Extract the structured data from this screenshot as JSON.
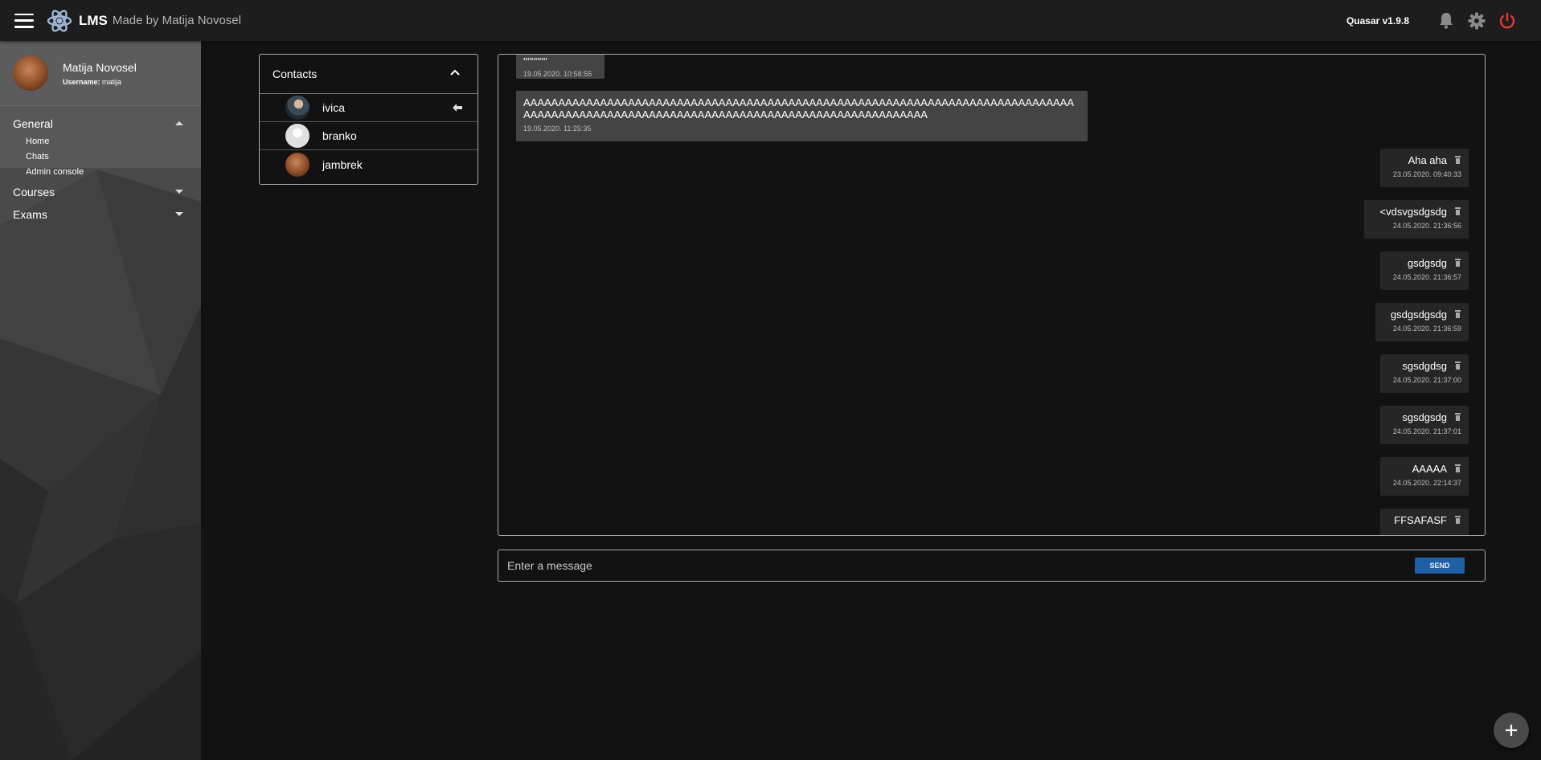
{
  "header": {
    "title": "LMS",
    "subtitle": "Made by Matija Novosel",
    "version": "Quasar v1.9.8",
    "icons": [
      "menu-icon",
      "atom-logo-icon",
      "bell-icon",
      "gear-icon",
      "power-icon"
    ]
  },
  "profile": {
    "name": "Matija Novosel",
    "username_label": "Username:",
    "username": "matija"
  },
  "nav": {
    "general": "General",
    "general_items": [
      "Home",
      "Chats",
      "Admin console"
    ],
    "courses": "Courses",
    "exams": "Exams"
  },
  "contacts": {
    "title": "Contacts",
    "items": [
      {
        "name": "ivica",
        "selected": true
      },
      {
        "name": "branko"
      },
      {
        "name": "jambrek"
      }
    ]
  },
  "messages": [
    {
      "text": "''''''''''''",
      "date": "19.05.2020. 10:58:55",
      "side": "received"
    },
    {
      "text": "AAAAAAAAAAAAAAAAAAAAAAAAAAAAAAAAAAAAAAAAAAAAAAAAAAAAAAAAAAAAAAAAAAAAAAAAAAAAAAAAAAAAAAAAAAAAAAAAAAAAAAAAAAAAAAAAAAAAAAAAAAAAAAAAAAAAAAAAA",
      "date": "19.05.2020. 11:25:35",
      "side": "received"
    },
    {
      "text": "Aha aha",
      "date": "23.05.2020. 09:40:33",
      "side": "sent"
    },
    {
      "text": "<vdsvgsdgsdg",
      "date": "24.05.2020. 21:36:56",
      "side": "sent"
    },
    {
      "text": "gsdgsdg",
      "date": "24.05.2020. 21:36:57",
      "side": "sent"
    },
    {
      "text": "gsdgsdgsdg",
      "date": "24.05.2020. 21:36:59",
      "side": "sent"
    },
    {
      "text": "sgsdgdsg",
      "date": "24.05.2020. 21:37:00",
      "side": "sent"
    },
    {
      "text": "sgsdgsdg",
      "date": "24.05.2020. 21:37:01",
      "side": "sent"
    },
    {
      "text": "AAAAA",
      "date": "24.05.2020. 22:14:37",
      "side": "sent"
    },
    {
      "text": "FFSAFASF",
      "date": "",
      "side": "sent"
    }
  ],
  "composer": {
    "placeholder": "Enter a message",
    "send_label": "SEND"
  },
  "colors": {
    "background": "#121212",
    "header": "#1d1d1d",
    "send_button": "#1f5fa5",
    "power": "#e53935"
  }
}
